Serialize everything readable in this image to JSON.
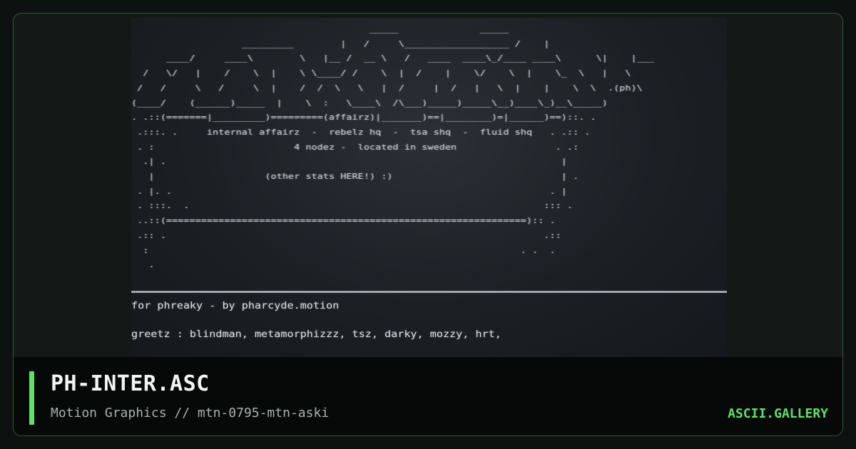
{
  "artwork": {
    "ascii_lines": [
      "                                         _____              _____",
      "                   _________        |   /     \\__________________ /    |",
      "      ____/     ____\\        \\   |__ /  __ \\   /   ____  ____\\_/____ ____\\      \\|    |___",
      "  /   \\/   |    /    \\  |    \\ \\____/ /    \\  |  /    |    \\/    \\  |    \\_  \\   |   \\",
      " /   /     \\   /     \\  |    /  /  \\   \\   |  /     |  /   |   \\  |    |    \\  \\  .(ph)\\",
      "(____/    (______)_____  |    \\  :   \\____\\  /\\___)_____)_____\\__)____\\_)__\\_____)",
      ". .::(=======|_________)=========(affairz)|_______)==|________)=|______)==)::. .",
      " .:::. .     internal affairz  -  rebelz hq  -  tsa shq  -  fluid shq   . .:: .",
      " . :                        4 nodez -  located in sweden                 . .:",
      "  .| .                                                                    |",
      "   |                   (other stats HERE!) :)                             | .",
      " . |. .                                                                 . |",
      " . :::.  .                                                             ::: .",
      " ..::(==============================================================):: .",
      " .:: .                                                                 .::",
      "  :                                                                . .  .",
      "   .                                                                       "
    ],
    "credit_line": "for phreaky - by pharcyde.motion",
    "greetz_line": "greetz : blindman, metamorphizzz, tsz, darky, mozzy, hrt,"
  },
  "footer": {
    "title": "PH-INTER.ASC",
    "subtitle": "Motion Graphics // mtn-0795-mtn-aski",
    "brand": "ASCII.GALLERY"
  },
  "colors": {
    "accent": "#5fe06a",
    "frame_border": "#2f5a30",
    "screen_bg": "#1c2025",
    "ascii_text": "#cfd5dc"
  }
}
